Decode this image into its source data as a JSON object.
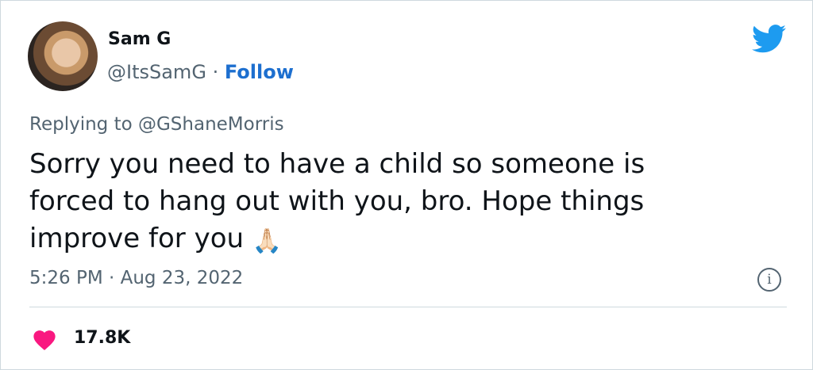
{
  "author": {
    "name": "Sam G",
    "handle": "@ItsSamG",
    "separator": "·",
    "follow_label": "Follow"
  },
  "reply": {
    "text": "Replying to @GShaneMorris"
  },
  "tweet": {
    "lines": [
      "Sorry you need to have a child so someone is",
      "forced to hang out with you, bro. Hope things",
      "improve for you"
    ],
    "emoji": "🙏🏻"
  },
  "timestamp": "5:26 PM · Aug 23, 2022",
  "info_glyph": "i",
  "likes": {
    "count": "17.8K"
  },
  "colors": {
    "brand": "#1d9bf0",
    "follow": "#1d6fcf",
    "heart": "#f91880",
    "secondary_text": "#536471"
  }
}
